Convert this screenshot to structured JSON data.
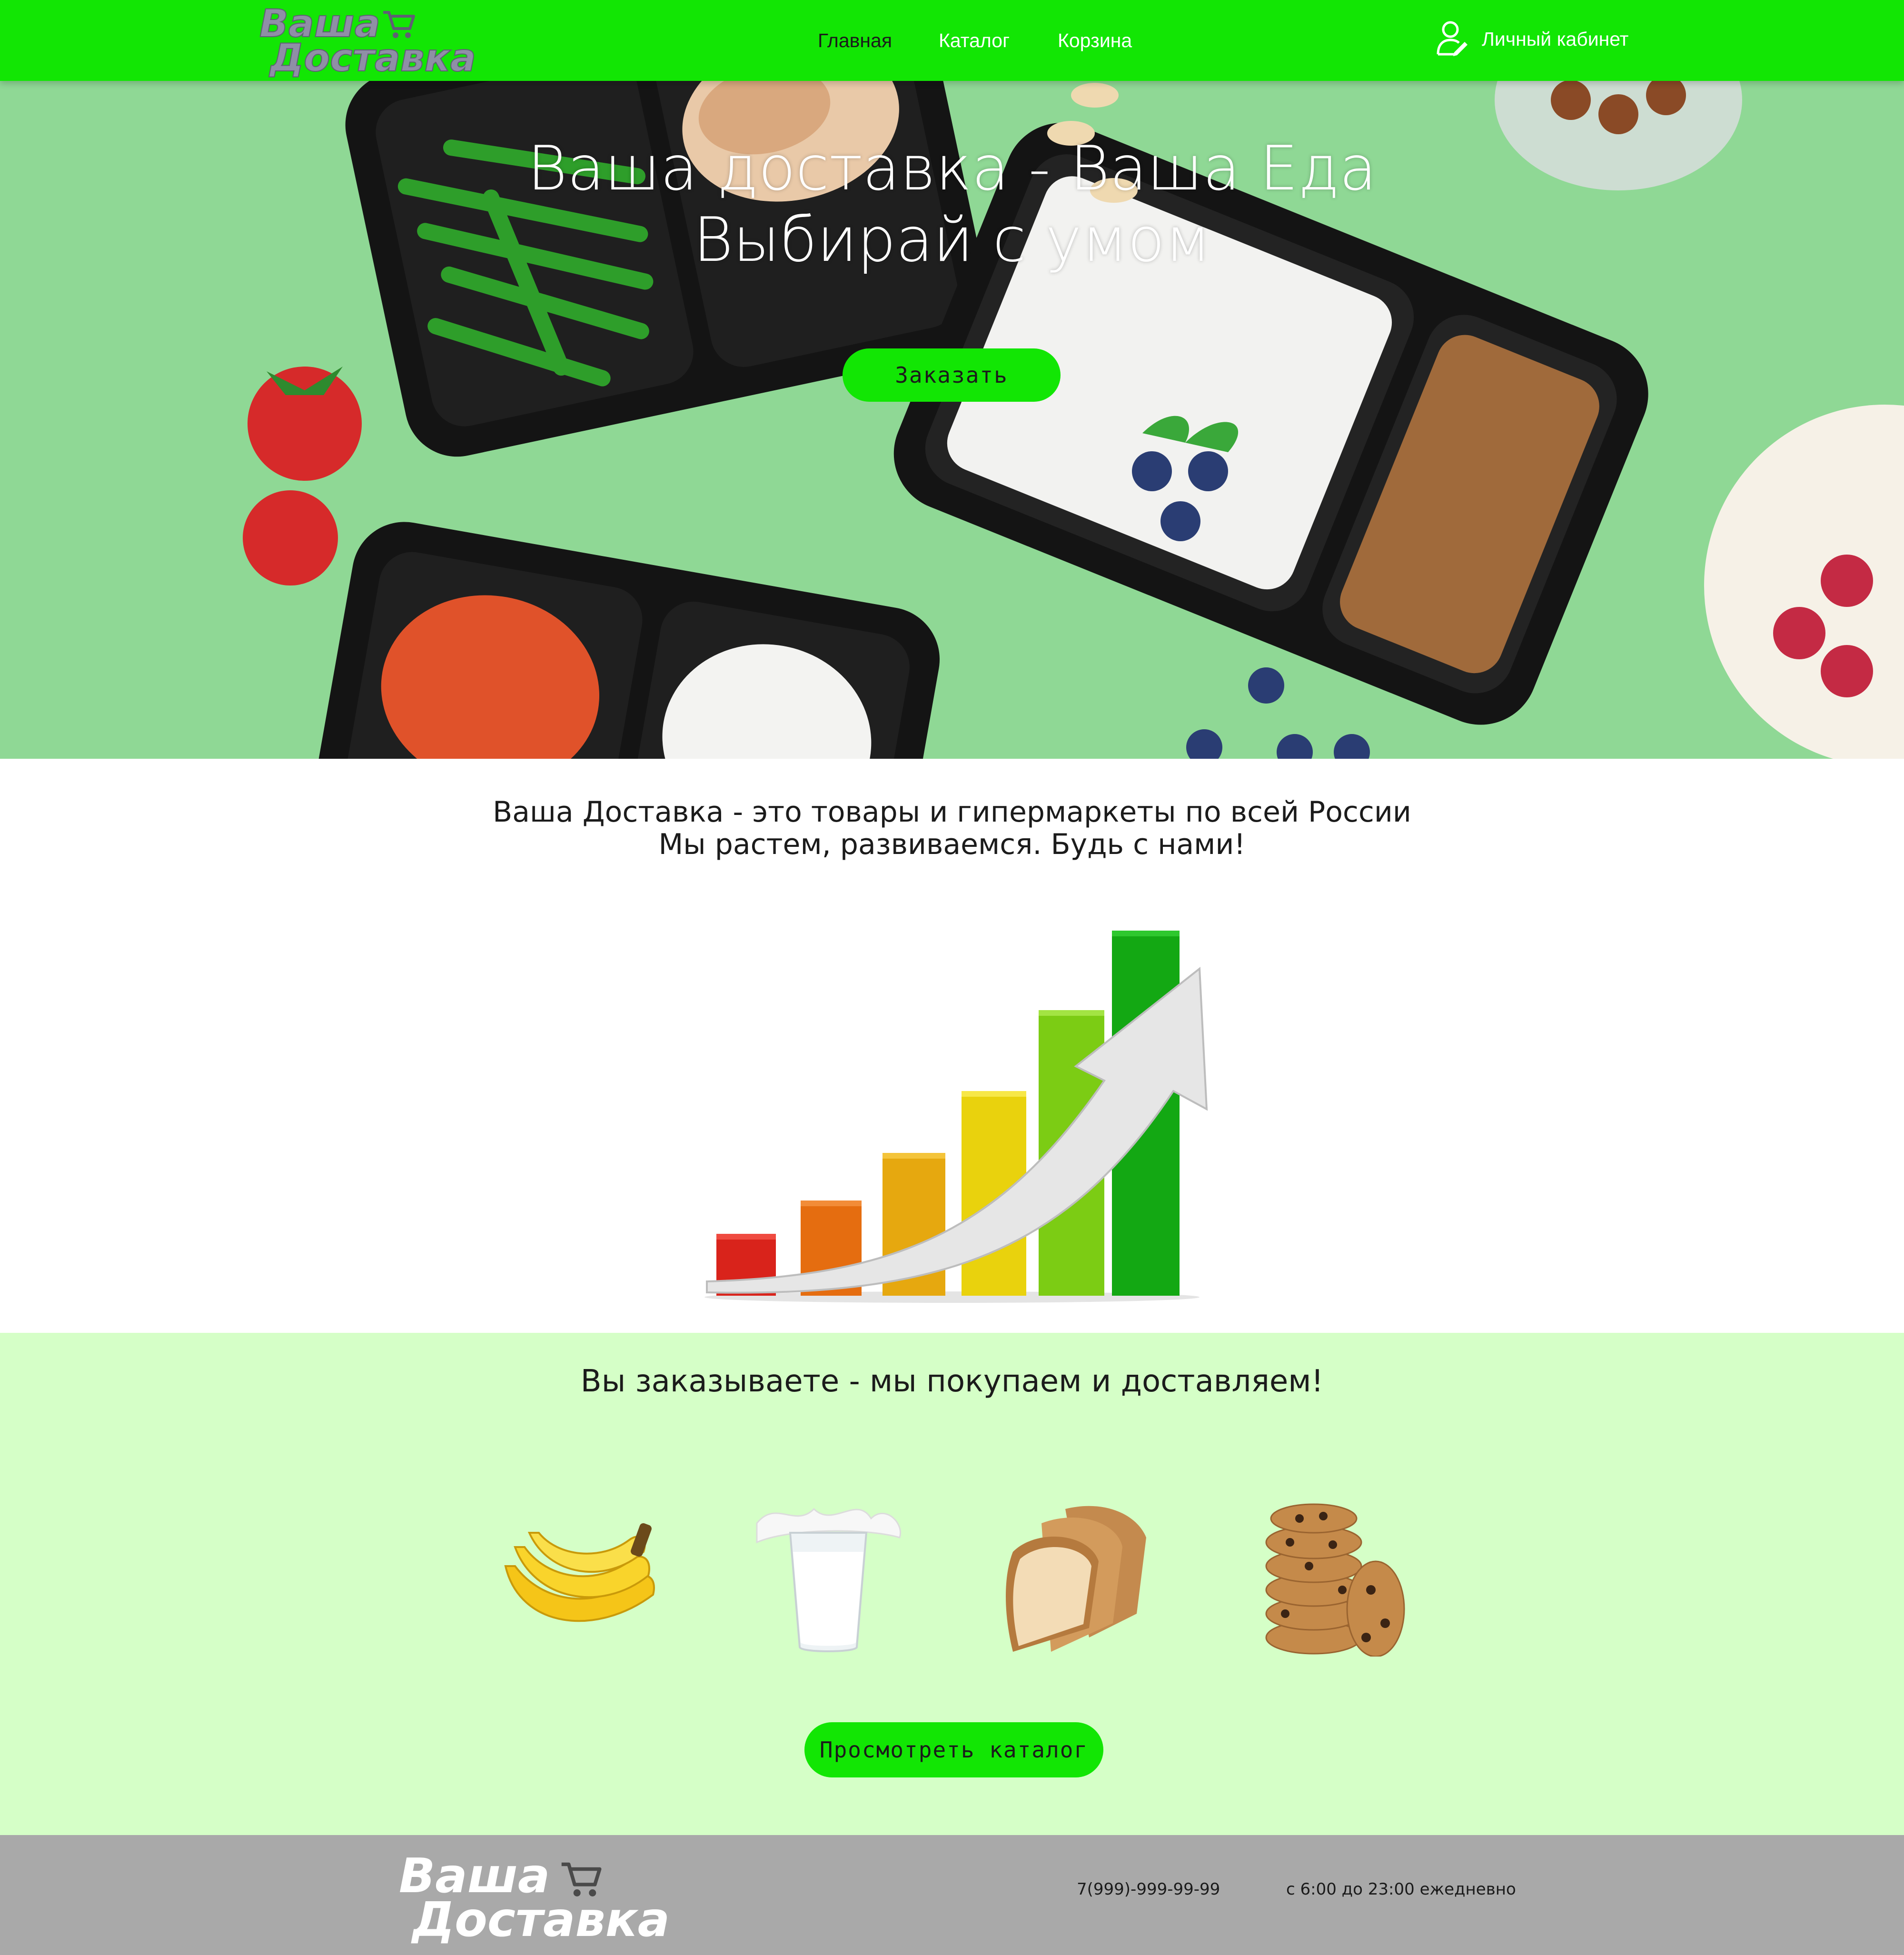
{
  "header": {
    "logo_line1": "Ваша",
    "logo_line2": "Доставка",
    "nav": [
      {
        "label": "Главная",
        "active": true
      },
      {
        "label": "Каталог",
        "active": false
      },
      {
        "label": "Корзина",
        "active": false
      }
    ],
    "account_label": "Личный кабинет"
  },
  "hero": {
    "title_line1": "Ваша доставка - Ваша Еда",
    "title_line2": "Выбирай с умом",
    "order_button": "Заказать"
  },
  "about": {
    "line1": "Ваша Доставка - это товары и гипермаркеты по всей России",
    "line2": "Мы растем, развиваемся. Будь с нами!"
  },
  "order_section": {
    "heading": "Вы заказываете - мы покупаем и доставляем!",
    "products": [
      "banana-image",
      "milk-image",
      "bread-image",
      "cookies-image"
    ],
    "catalog_button": "Просмотреть каталог"
  },
  "footer": {
    "logo_line1": "Ваша",
    "logo_line2": "Доставка",
    "phone": "7(999)-999-99-99",
    "hours": "с 6:00 до 23:00 ежедневно"
  },
  "colors": {
    "brand_green": "#12e604",
    "hero_bg": "#8fd895",
    "section_bg": "#d5ffc7",
    "footer_bg": "#a9a9a9"
  }
}
